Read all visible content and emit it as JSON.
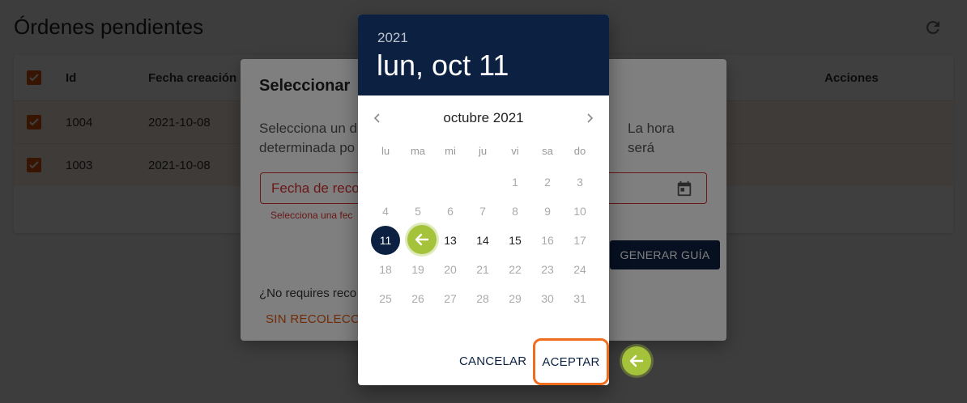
{
  "page": {
    "title": "Órdenes pendientes"
  },
  "table": {
    "columns": [
      "Id",
      "Fecha creación",
      "Acciones"
    ],
    "rows": [
      {
        "id": "1004",
        "date": "2021-10-08"
      },
      {
        "id": "1003",
        "date": "2021-10-08"
      }
    ]
  },
  "dialog": {
    "title": "Seleccionar",
    "text_line1_left": "Selecciona un d",
    "text_line1_right": "La hora será",
    "text_line2": "determinada po",
    "date_placeholder": "Fecha de reco",
    "helper": "Selecciona una fec",
    "generate_label": "GENERAR GUÍA",
    "no_pickup_question": "¿No requires reco",
    "no_pickup_link": "SIN RECOLECCIÓ"
  },
  "picker": {
    "year": "2021",
    "selected_date_label": "lun, oct 11",
    "month_label": "octubre 2021",
    "weekdays": [
      "lu",
      "ma",
      "mi",
      "ju",
      "vi",
      "sa",
      "do"
    ],
    "selected_day": 11,
    "enabled_days": [
      11,
      13,
      14,
      15
    ],
    "cancel_label": "CANCELAR",
    "ok_label": "ACEPTAR"
  },
  "colors": {
    "primary": "#0c2142",
    "accent": "#e3570f",
    "error": "#d32f2f",
    "highlight": "#f06d1e",
    "pointer": "#a4c23a"
  }
}
